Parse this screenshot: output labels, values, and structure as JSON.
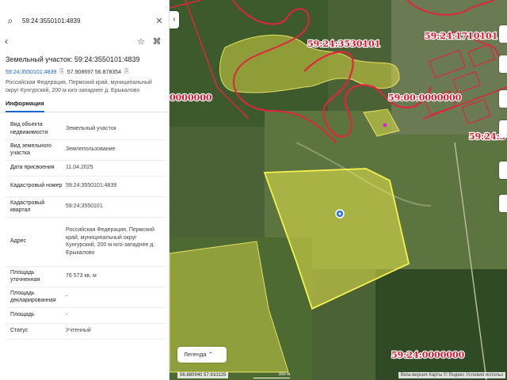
{
  "search": {
    "value": "59:24:3550101:4839"
  },
  "title": "Земельный участок: 59:24:3550101:4839",
  "cad_number": "59:24:3550101:4839",
  "coordinates": "57.908697 56.878354",
  "address_short": "Российская Федерация, Пермский край, муниципальный округ Кунгурский, 200 м юго-западнее д. Ерыкалово",
  "tab_label": "Информация",
  "info_rows": [
    {
      "label": "Вид объекта недвижимости",
      "value": "Земельный участок"
    },
    {
      "label": "Вид земельного участка",
      "value": "Землепользование"
    },
    {
      "label": "Дата присвоения",
      "value": "11.04.2025"
    },
    {
      "label": "Кадастровый номер",
      "value": "59:24:3550101:4839"
    },
    {
      "label": "Кадастровый квартал",
      "value": "59:24:3550101"
    },
    {
      "label": "Адрес",
      "value": "Российская Федерация, Пермский край, муниципальный округ Кунгурский, 200 м юго-западнее д. Ерыкалово"
    },
    {
      "label": "Площадь уточненная",
      "value": "76 573 кв. м"
    },
    {
      "label": "Площадь декларированная",
      "value": "-"
    },
    {
      "label": "Площадь",
      "value": "-"
    },
    {
      "label": "Статус",
      "value": "Учтенный"
    }
  ],
  "map": {
    "labels": {
      "l1": "59:24:3530101",
      "l2": "59:24:1710101",
      "l3": "59:00:0000000",
      "l4": "0000000",
      "l5": "59:24:3",
      "l6": "59:24:0000000"
    },
    "legend": "Легенда",
    "coords": "56.880940  57.910225",
    "scale": "300 м",
    "beta": "Beta-версия",
    "credits": "Карты © Яндекс  Условия использ"
  },
  "colors": {
    "accent": "#1e63d6",
    "boundary": "#e0263a",
    "parcel": "#f3f04a"
  }
}
